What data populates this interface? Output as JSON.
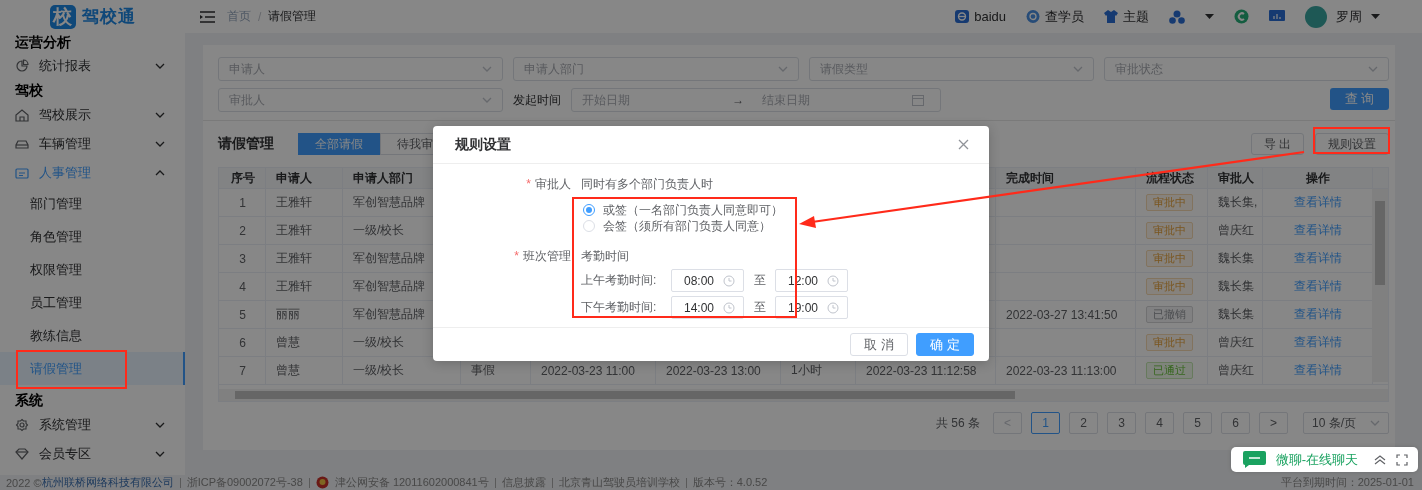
{
  "sidebar": {
    "logo": {
      "badge": "校",
      "name": "驾校通"
    },
    "sections": [
      {
        "title": "运营分析",
        "items": [
          {
            "label": "统计报表",
            "expanded": false
          }
        ]
      },
      {
        "title": "驾校",
        "items": [
          {
            "label": "驾校展示",
            "expanded": false
          },
          {
            "label": "车辆管理",
            "expanded": false
          },
          {
            "label": "人事管理",
            "expanded": true,
            "children": [
              {
                "label": "部门管理",
                "selected": false
              },
              {
                "label": "角色管理",
                "selected": false
              },
              {
                "label": "权限管理",
                "selected": false
              },
              {
                "label": "员工管理",
                "selected": false
              },
              {
                "label": "教练信息",
                "selected": false
              },
              {
                "label": "请假管理",
                "selected": true
              }
            ]
          }
        ]
      },
      {
        "title": "系统",
        "items": [
          {
            "label": "系统管理",
            "expanded": false
          },
          {
            "label": "会员专区",
            "expanded": false
          }
        ]
      }
    ]
  },
  "topbar": {
    "breadcrumb": [
      "首页",
      "请假管理"
    ],
    "breadcrumb_separator": "/",
    "links": [
      "baidu",
      "查学员",
      "主题"
    ],
    "user": "罗周"
  },
  "filters": {
    "selects": [
      "申请人",
      "申请人部门",
      "请假类型",
      "审批状态",
      "审批人"
    ],
    "date_label": "发起时间",
    "start_placeholder": "开始日期",
    "range_separator": "→",
    "end_placeholder": "结束日期",
    "search_button": "查 询"
  },
  "toolbar": {
    "title": "请假管理",
    "tabs": [
      {
        "label": "全部请假",
        "selected": true
      },
      {
        "label": "待我审",
        "selected": false
      }
    ],
    "buttons": [
      "导 出",
      "规则设置"
    ]
  },
  "table": {
    "columns_left": [
      "序号",
      "申请人",
      "申请人部门"
    ],
    "columns_right": [
      "完成时间",
      "流程状态",
      "审批人",
      "操作"
    ],
    "rows": [
      {
        "no": "1",
        "applicant": "王雅轩",
        "department": "军创智慧品牌",
        "status": {
          "label": "审批中",
          "kind": "pending"
        },
        "approver": "魏长集,",
        "action": "查看详情"
      },
      {
        "no": "2",
        "applicant": "王雅轩",
        "department": "一级/校长",
        "status": {
          "label": "审批中",
          "kind": "pending"
        },
        "approver": "曾庆红",
        "action": "查看详情"
      },
      {
        "no": "3",
        "applicant": "王雅轩",
        "department": "军创智慧品牌",
        "status": {
          "label": "审批中",
          "kind": "pending"
        },
        "approver": "魏长集",
        "action": "查看详情"
      },
      {
        "no": "4",
        "applicant": "王雅轩",
        "department": "军创智慧品牌",
        "status": {
          "label": "审批中",
          "kind": "pending"
        },
        "approver": "魏长集",
        "action": "查看详情"
      },
      {
        "no": "5",
        "applicant": "丽丽",
        "department": "军创智慧品牌",
        "completed": "2022-03-27 13:41:50",
        "status": {
          "label": "已撤销",
          "kind": "revoked"
        },
        "approver": "魏长集",
        "action": "查看详情"
      },
      {
        "no": "6",
        "applicant": "曾慧",
        "department": "一级/校长",
        "status": {
          "label": "审批中",
          "kind": "pending"
        },
        "approver": "曾庆红",
        "action": "查看详情"
      },
      {
        "no": "7",
        "applicant": "曾慧",
        "department": "一级/校长",
        "column_4": "事假",
        "column_5": "2022-03-23 11:00",
        "column_6": "2022-03-23 13:00",
        "column_7": "1小时",
        "column_8": "2022-03-23 11:12:58",
        "completed": "2022-03-23 11:13:00",
        "status": {
          "label": "已通过",
          "kind": "approved"
        },
        "approver": "曾庆红",
        "action": "查看详情"
      }
    ]
  },
  "pagination": {
    "total": "共 56 条",
    "prev": "<",
    "pages": [
      {
        "label": "1",
        "selected": true
      },
      {
        "label": "2",
        "selected": false
      },
      {
        "label": "3",
        "selected": false
      },
      {
        "label": "4",
        "selected": false
      },
      {
        "label": "5",
        "selected": false
      },
      {
        "label": "6",
        "selected": false
      }
    ],
    "next": ">",
    "page_size": "10 条/页"
  },
  "dialog": {
    "title": "规则设置",
    "approver": {
      "mark": "*",
      "label": "审批人",
      "hint": "同时有多个部门负责人时",
      "options": [
        {
          "label": "或签（一名部门负责人同意即可）",
          "selected": true
        },
        {
          "label": "会签（须所有部门负责人同意）",
          "selected": false
        }
      ]
    },
    "shift": {
      "mark": "*",
      "label": "班次管理",
      "heading": "考勤时间",
      "periods": [
        {
          "label": "上午考勤时间:",
          "start": "08:00",
          "separator": "至",
          "end": "12:00"
        },
        {
          "label": "下午考勤时间:",
          "start": "14:00",
          "separator": "至",
          "end": "19:00"
        }
      ]
    },
    "buttons": [
      {
        "label": "取 消",
        "kind": "default"
      },
      {
        "label": "确 定",
        "kind": "primary"
      }
    ]
  },
  "chat": {
    "title": "微聊-在线聊天"
  },
  "footer": {
    "items": [
      {
        "text": "2022 ©",
        "kind": "plain"
      },
      {
        "text": "杭州联桥网络科技有限公司",
        "kind": "link"
      },
      {
        "text": "浙ICP备09002072号-38",
        "kind": "text"
      },
      {
        "text": "津公网安备 12011602000841号",
        "kind": "police"
      },
      {
        "text": "信息披露",
        "kind": "text"
      },
      {
        "text": "北京青山驾驶员培训学校",
        "kind": "text"
      },
      {
        "text": "版本号：4.0.52",
        "kind": "text"
      }
    ],
    "expiry": "平台到期时间：2025-01-01"
  }
}
